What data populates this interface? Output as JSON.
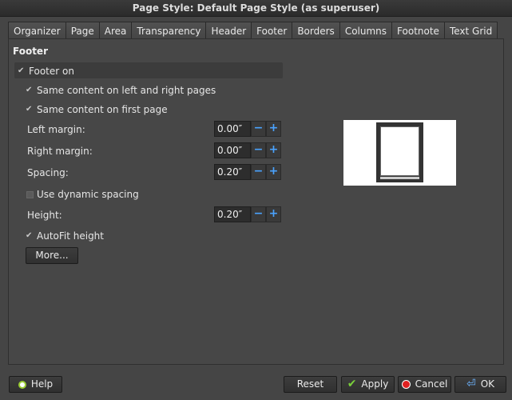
{
  "window": {
    "title": "Page Style: Default Page Style (as superuser)"
  },
  "tabs": [
    {
      "label": "Organizer"
    },
    {
      "label": "Page"
    },
    {
      "label": "Area"
    },
    {
      "label": "Transparency"
    },
    {
      "label": "Header"
    },
    {
      "label": "Footer"
    },
    {
      "label": "Borders"
    },
    {
      "label": "Columns"
    },
    {
      "label": "Footnote"
    },
    {
      "label": "Text Grid"
    }
  ],
  "active_tab": "Footer",
  "footer": {
    "section_title": "Footer",
    "footer_on": {
      "label": "Footer on",
      "checked": true
    },
    "same_lr": {
      "label": "Same content on left and right pages",
      "checked": true
    },
    "same_first": {
      "label": "Same content on first page",
      "checked": true
    },
    "left_margin": {
      "label": "Left margin:",
      "value": "0.00″"
    },
    "right_margin": {
      "label": "Right margin:",
      "value": "0.00″"
    },
    "spacing": {
      "label": "Spacing:",
      "value": "0.20″"
    },
    "dynamic_spacing": {
      "label": "Use dynamic spacing",
      "checked": false
    },
    "height": {
      "label": "Height:",
      "value": "0.20″"
    },
    "autofit": {
      "label": "AutoFit height",
      "checked": true
    },
    "more_button": "More..."
  },
  "spin": {
    "minus": "−",
    "plus": "+"
  },
  "buttons": {
    "help": "Help",
    "reset": "Reset",
    "apply": "Apply",
    "cancel": "Cancel",
    "ok": "OK"
  }
}
